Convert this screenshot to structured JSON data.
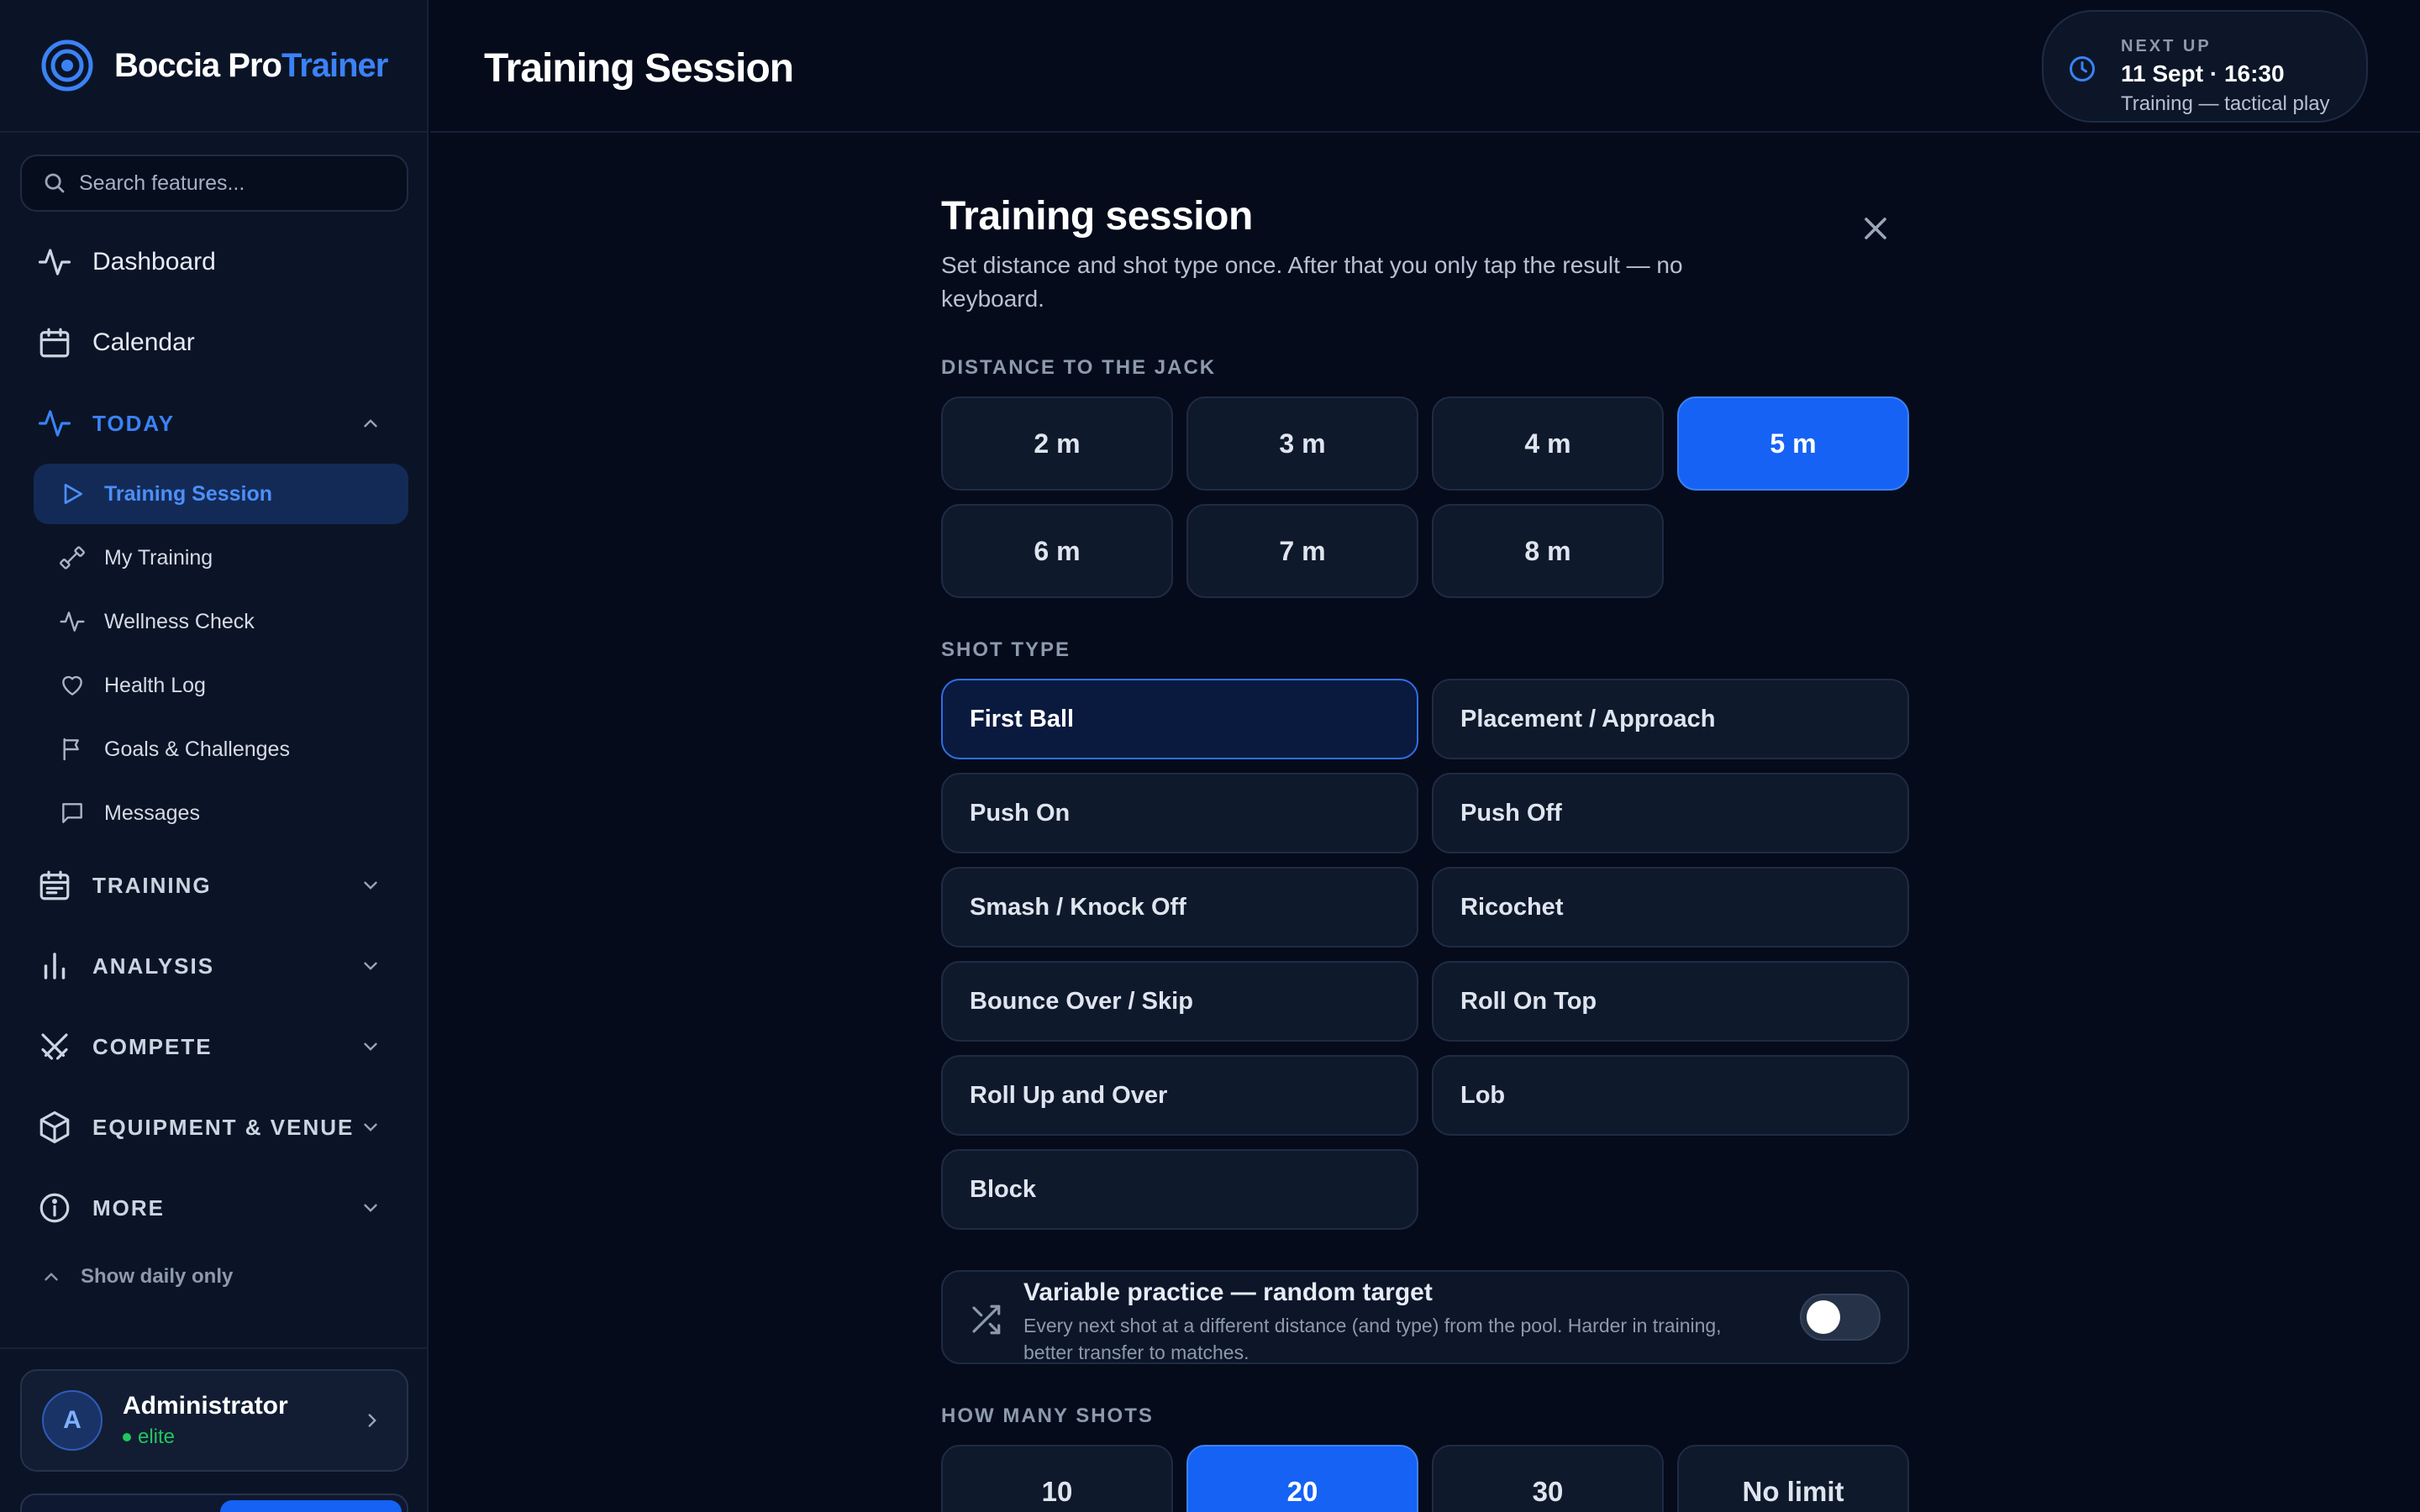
{
  "brand": {
    "name_primary": "Boccia Pro",
    "name_accent": "Trainer",
    "accent_color": "#3b82f6"
  },
  "search": {
    "placeholder": "Search features..."
  },
  "nav": {
    "dashboard": "Dashboard",
    "calendar": "Calendar",
    "today_section": "TODAY",
    "today_items": [
      "Training Session",
      "My Training",
      "Wellness Check",
      "Health Log",
      "Goals & Challenges",
      "Messages"
    ],
    "training_section": "TRAINING",
    "analysis_section": "ANALYSIS",
    "compete_section": "COMPETE",
    "equipment_section": "EQUIPMENT & VENUE",
    "more_section": "MORE",
    "show_daily": "Show daily only"
  },
  "user": {
    "initial": "A",
    "name": "Administrator",
    "role": "elite"
  },
  "header": {
    "title": "Training Session",
    "next_up_label": "NEXT UP",
    "next_up_date": "11 Sept · 16:30",
    "next_up_desc": "Training — tactical play"
  },
  "session": {
    "title": "Training session",
    "description": "Set distance and shot type once. After that you only tap the result — no keyboard.",
    "distance_label": "DISTANCE TO THE JACK",
    "distances": [
      "2 m",
      "3 m",
      "4 m",
      "5 m",
      "6 m",
      "7 m",
      "8 m"
    ],
    "selected_distance": "5 m",
    "shot_label": "SHOT TYPE",
    "shots": [
      "First Ball",
      "Placement / Approach",
      "Push On",
      "Push Off",
      "Smash / Knock Off",
      "Ricochet",
      "Bounce Over / Skip",
      "Roll On Top",
      "Roll Up and Over",
      "Lob",
      "Block"
    ],
    "selected_shot": "First Ball",
    "variable_title": "Variable practice — random target",
    "variable_desc": "Every next shot at a different distance (and type) from the pool. Harder in training, better transfer to matches.",
    "variable_enabled": false,
    "count_label": "HOW MANY SHOTS",
    "counts": [
      "10",
      "20",
      "30",
      "No limit"
    ],
    "selected_count": "20"
  }
}
